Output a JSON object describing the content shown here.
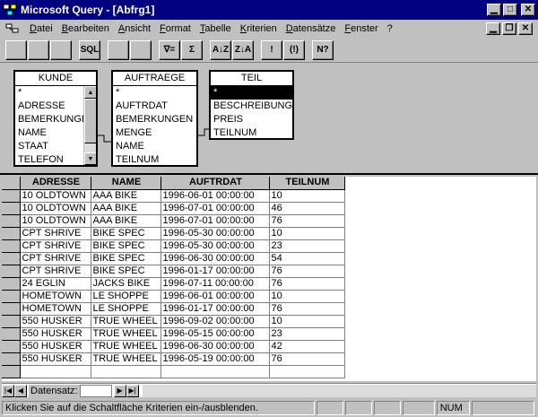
{
  "window": {
    "title": "Microsoft Query - [Abfrg1]"
  },
  "menu": {
    "items": [
      "Datei",
      "Bearbeiten",
      "Ansicht",
      "Format",
      "Tabelle",
      "Kriterien",
      "Datensätze",
      "Fenster",
      "?"
    ]
  },
  "toolbar": {
    "buttons": [
      {
        "name": "new-query-button",
        "icon": "new-icon",
        "glyph": ""
      },
      {
        "name": "open-query-button",
        "icon": "open-icon",
        "glyph": ""
      },
      {
        "name": "save-query-button",
        "icon": "save-icon",
        "glyph": ""
      },
      {
        "name": "sql-button",
        "icon": "sql-icon",
        "glyph": "SQL"
      },
      {
        "name": "show-tables-button",
        "icon": "tables-icon",
        "glyph": ""
      },
      {
        "name": "add-table-button",
        "icon": "add-table-icon",
        "glyph": ""
      },
      {
        "name": "criteria-toggle-button",
        "icon": "criteria-icon",
        "glyph": "∇="
      },
      {
        "name": "totals-button",
        "icon": "sigma-icon",
        "glyph": "Σ"
      },
      {
        "name": "sort-ascending-button",
        "icon": "sort-asc-icon",
        "glyph": "A↓Z"
      },
      {
        "name": "sort-descending-button",
        "icon": "sort-desc-icon",
        "glyph": "Z↓A"
      },
      {
        "name": "query-now-button",
        "icon": "exclamation-icon",
        "glyph": "!"
      },
      {
        "name": "auto-query-button",
        "icon": "auto-query-icon",
        "glyph": "(!)"
      },
      {
        "name": "help-button",
        "icon": "help-icon",
        "glyph": "N?"
      }
    ]
  },
  "tables": [
    {
      "id": "kunde",
      "name": "KUNDE",
      "fields": [
        "*",
        "ADRESSE",
        "BEMERKUNGEN",
        "NAME",
        "STAAT",
        "TELEFON"
      ],
      "selected": -1
    },
    {
      "id": "auftraege",
      "name": "AUFTRAEGE",
      "fields": [
        "*",
        "AUFTRDAT",
        "BEMERKUNGEN",
        "MENGE",
        "NAME",
        "TEILNUM"
      ],
      "selected": -1
    },
    {
      "id": "teil",
      "name": "TEIL",
      "fields": [
        "*",
        "BESCHREIBUNG",
        "PREIS",
        "TEILNUM"
      ],
      "selected": 0
    }
  ],
  "grid": {
    "columns": [
      "ADRESSE",
      "NAME",
      "AUFTRDAT",
      "TEILNUM"
    ],
    "rows": [
      [
        "10 OLDTOWN",
        "AAA BIKE",
        "1996-06-01 00:00:00",
        "10"
      ],
      [
        "10 OLDTOWN",
        "AAA BIKE",
        "1996-07-01 00:00:00",
        "46"
      ],
      [
        "10 OLDTOWN",
        "AAA BIKE",
        "1996-07-01 00:00:00",
        "76"
      ],
      [
        "CPT SHRIVE",
        "BIKE SPEC",
        "1996-05-30 00:00:00",
        "10"
      ],
      [
        "CPT SHRIVE",
        "BIKE SPEC",
        "1996-05-30 00:00:00",
        "23"
      ],
      [
        "CPT SHRIVE",
        "BIKE SPEC",
        "1996-06-30 00:00:00",
        "54"
      ],
      [
        "CPT SHRIVE",
        "BIKE SPEC",
        "1996-01-17 00:00:00",
        "76"
      ],
      [
        "24 EGLIN",
        "JACKS BIKE",
        "1996-07-11 00:00:00",
        "76"
      ],
      [
        "HOMETOWN",
        "LE SHOPPE",
        "1996-06-01 00:00:00",
        "10"
      ],
      [
        "HOMETOWN",
        "LE SHOPPE",
        "1996-01-17 00:00:00",
        "76"
      ],
      [
        "550 HUSKER",
        "TRUE WHEEL",
        "1996-09-02 00:00:00",
        "10"
      ],
      [
        "550 HUSKER",
        "TRUE WHEEL",
        "1996-05-15 00:00:00",
        "23"
      ],
      [
        "550 HUSKER",
        "TRUE WHEEL",
        "1996-06-30 00:00:00",
        "42"
      ],
      [
        "550 HUSKER",
        "TRUE WHEEL",
        "1996-05-19 00:00:00",
        "76"
      ]
    ]
  },
  "nav": {
    "label": "Datensatz:",
    "value": ""
  },
  "status": {
    "message": "Klicken Sie auf die Schaltfläche Kriterien ein-/ausblenden.",
    "num": "NUM"
  },
  "colors": {
    "titlebar": "#000080",
    "face": "#c0c0c0",
    "selection": "#000000"
  }
}
